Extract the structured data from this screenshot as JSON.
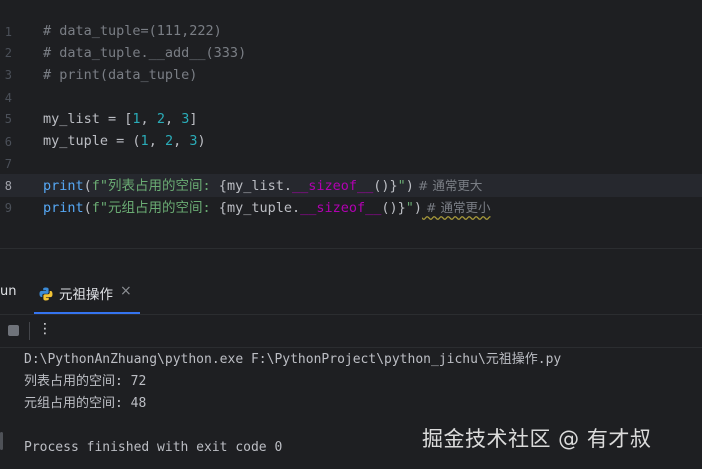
{
  "editor": {
    "line_numbers": [
      "1",
      "2",
      "3",
      "4",
      "5",
      "6",
      "7",
      "8",
      "9"
    ],
    "lines": {
      "l1": "# data_tuple=(111,222)",
      "l2": "# data_tuple.__add__(333)",
      "l3": "# print(data_tuple)",
      "l5_a": "my_list = [",
      "l5_n1": "1",
      "l5_c1": ", ",
      "l5_n2": "2",
      "l5_c2": ", ",
      "l5_n3": "3",
      "l5_end": "]",
      "l6_a": "my_tuple = (",
      "l6_n1": "1",
      "l6_c1": ", ",
      "l6_n2": "2",
      "l6_c2": ", ",
      "l6_n3": "3",
      "l6_end": ")",
      "l8_fn": "print",
      "l8_p": "(",
      "l8_str": "f\"列表占用的空间: ",
      "l8_inj_open": "{",
      "l8_var": "my_list.",
      "l8_dunder": "__sizeof__",
      "l8_call": "()",
      "l8_inj_close": "}",
      "l8_str_end": "\"",
      "l8_close": ")",
      "l8_cmt": " # 通常更大",
      "l9_fn": "print",
      "l9_p": "(",
      "l9_str": "f\"元组占用的空间: ",
      "l9_inj_open": "{",
      "l9_var": "my_tuple.",
      "l9_dunder": "__sizeof__",
      "l9_call": "()",
      "l9_inj_close": "}",
      "l9_str_end": "\"",
      "l9_close": ")",
      "l9_cmt": " # 通常更小"
    }
  },
  "run_panel": {
    "run_label": "un",
    "tab_label": "元祖操作",
    "tab_close": "×",
    "more_label": "⋮"
  },
  "console": {
    "command": "D:\\PythonAnZhuang\\python.exe F:\\PythonProject\\python_jichu\\元祖操作.py",
    "out1": "列表占用的空间: 72",
    "out2": "元组占用的空间: 48",
    "exit": "Process finished with exit code 0"
  },
  "watermark": "掘金技术社区 @ 有才叔",
  "colors": {
    "background": "#1e1f22",
    "comment": "#7a7e85",
    "number": "#2aacb8",
    "function": "#56a8f5",
    "string": "#6aab73",
    "dunder": "#b200b2",
    "accent": "#3574f0"
  }
}
